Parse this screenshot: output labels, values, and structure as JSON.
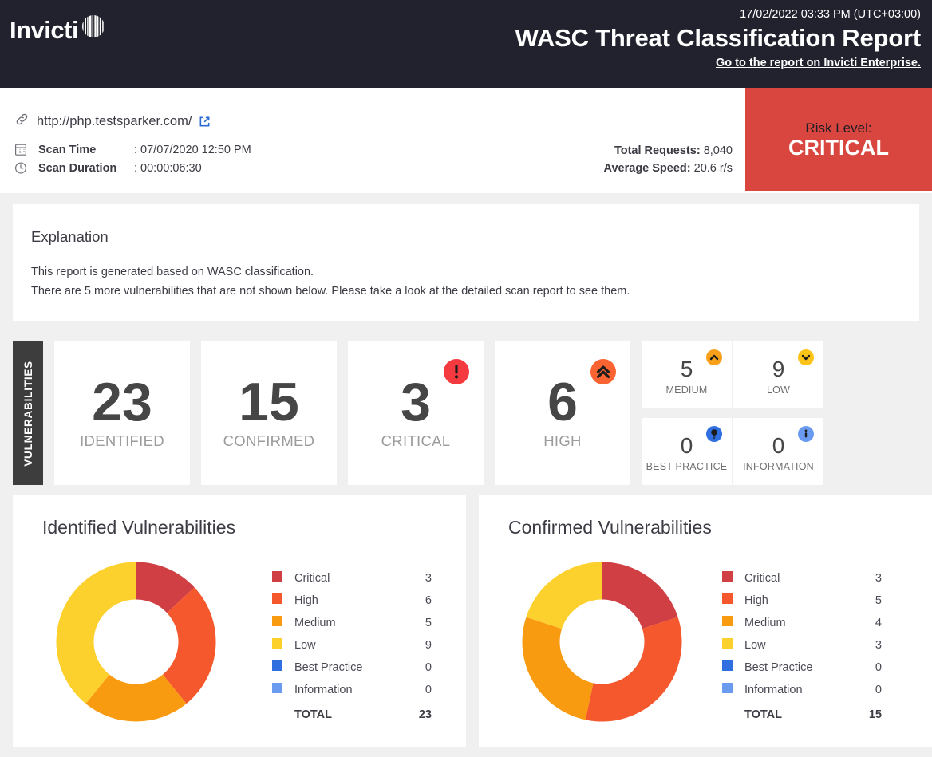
{
  "header": {
    "logo_text": "Invicti",
    "logo_mark_icon": "invicti-barcode-circle-icon",
    "date": "17/02/2022 03:33 PM (UTC+03:00)",
    "title": "WASC Threat Classification Report",
    "link_label": "Go to the report on Invicti Enterprise."
  },
  "scan_info": {
    "link_icon": "link-icon",
    "url": "http://php.testsparker.com/",
    "external_link_icon": "external-link-icon",
    "rows": [
      {
        "icon": "calendar-icon",
        "label": "Scan Time",
        "value": ": 07/07/2020 12:50 PM"
      },
      {
        "icon": "clock-icon",
        "label": "Scan Duration",
        "value": ": 00:00:06:30"
      }
    ],
    "total_requests_label": "Total Requests:",
    "total_requests_value": "8,040",
    "average_speed_label": "Average Speed:",
    "average_speed_value": "20.6 r/s",
    "risk_label": "Risk Level:",
    "risk_value": "CRITICAL",
    "risk_color": "#d9453f"
  },
  "explanation": {
    "heading": "Explanation",
    "line1": "This report is generated based on WASC classification.",
    "line2": "There are 5 more vulnerabilities that are not shown below. Please take a look at the detailed scan report to see them."
  },
  "stats": {
    "section_label": "VULNERABILITIES",
    "big_cards": [
      {
        "value": "23",
        "label": "IDENTIFIED",
        "badge_icon": null,
        "badge_color": null
      },
      {
        "value": "15",
        "label": "CONFIRMED",
        "badge_icon": null,
        "badge_color": null
      },
      {
        "value": "3",
        "label": "CRITICAL",
        "badge_icon": "exclamation-badge-icon",
        "badge_color": "#f4393f"
      },
      {
        "value": "6",
        "label": "HIGH",
        "badge_icon": "double-chevron-up-badge-icon",
        "badge_color": "#fa6432"
      }
    ],
    "small_cards": [
      {
        "value": "5",
        "label": "MEDIUM",
        "badge_icon": "chevron-up-badge-icon",
        "badge_color": "#f9a01b"
      },
      {
        "value": "9",
        "label": "LOW",
        "badge_icon": "chevron-down-badge-icon",
        "badge_color": "#fcc419"
      },
      {
        "value": "0",
        "label": "BEST PRACTICE",
        "badge_icon": "lightbulb-badge-icon",
        "badge_color": "#2f6fe0"
      },
      {
        "value": "0",
        "label": "INFORMATION",
        "badge_icon": "info-badge-icon",
        "badge_color": "#6b9bf0"
      }
    ]
  },
  "colors": {
    "critical": "#cf3f43",
    "high": "#f4582c",
    "medium": "#f99b11",
    "low": "#fcd12e",
    "best_practice": "#2f6fe0",
    "information": "#6b9bf0"
  },
  "chart_data": [
    {
      "type": "pie",
      "variant": "donut",
      "title": "Identified Vulnerabilities",
      "categories": [
        "Critical",
        "High",
        "Medium",
        "Low",
        "Best Practice",
        "Information"
      ],
      "values": [
        3,
        6,
        5,
        9,
        0,
        0
      ],
      "colors": [
        "#cf3f43",
        "#f4582c",
        "#f99b11",
        "#fcd12e",
        "#2f6fe0",
        "#6b9bf0"
      ],
      "total_label": "TOTAL",
      "total": 23,
      "legend_position": "right",
      "start_angle": 0
    },
    {
      "type": "pie",
      "variant": "donut",
      "title": "Confirmed Vulnerabilities",
      "categories": [
        "Critical",
        "High",
        "Medium",
        "Low",
        "Best Practice",
        "Information"
      ],
      "values": [
        3,
        5,
        4,
        3,
        0,
        0
      ],
      "colors": [
        "#cf3f43",
        "#f4582c",
        "#f99b11",
        "#fcd12e",
        "#2f6fe0",
        "#6b9bf0"
      ],
      "total_label": "TOTAL",
      "total": 15,
      "legend_position": "right",
      "start_angle": 0
    }
  ]
}
